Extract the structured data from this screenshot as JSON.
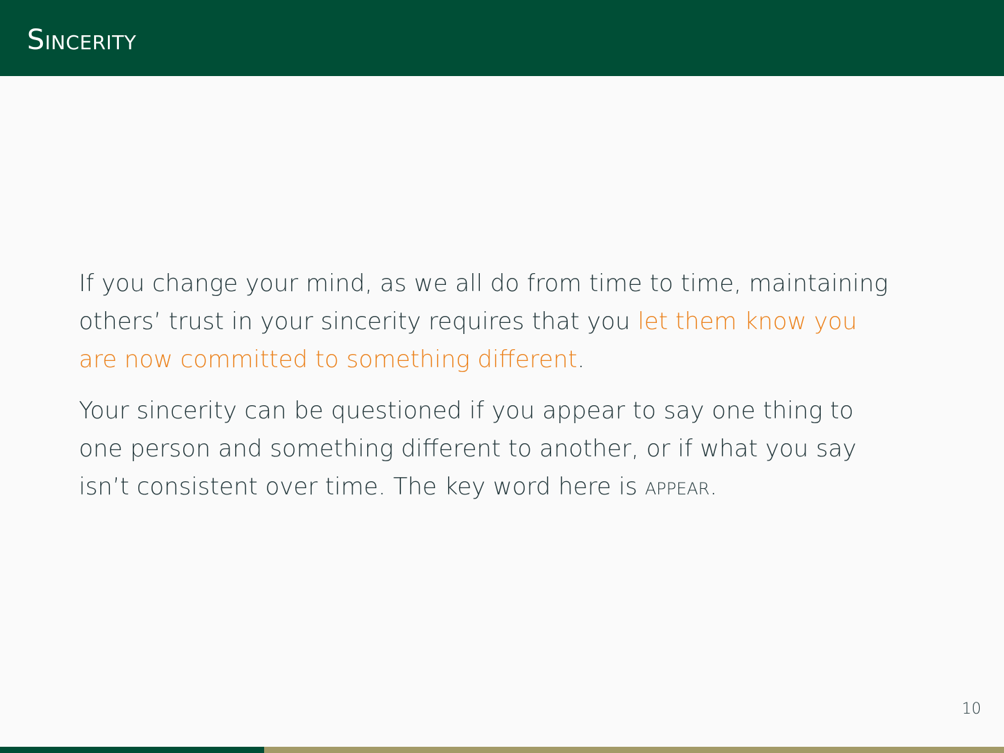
{
  "slide": {
    "title": "Sincerity",
    "page_number": "10",
    "progress_fraction": 0.263
  },
  "body": {
    "paragraph1": {
      "text_before": "If you change your mind, as we all do from time to time, maintaining others’ trust in your sincerity requires that you ",
      "highlight": "let them know you are now committed to something different",
      "text_after": "."
    },
    "paragraph2": {
      "text_before": "Your sincerity can be questioned if you appear to say one thing to one person and something different to another, or if what you say isn’t consistent over time. The key word here is ",
      "emphasis": "appear",
      "text_after": "."
    }
  },
  "colors": {
    "header_background": "#004e36",
    "body_text": "#23373b",
    "highlight_text": "#eb811b",
    "progress_done": "#004e36",
    "progress_remaining": "#a39a68"
  }
}
